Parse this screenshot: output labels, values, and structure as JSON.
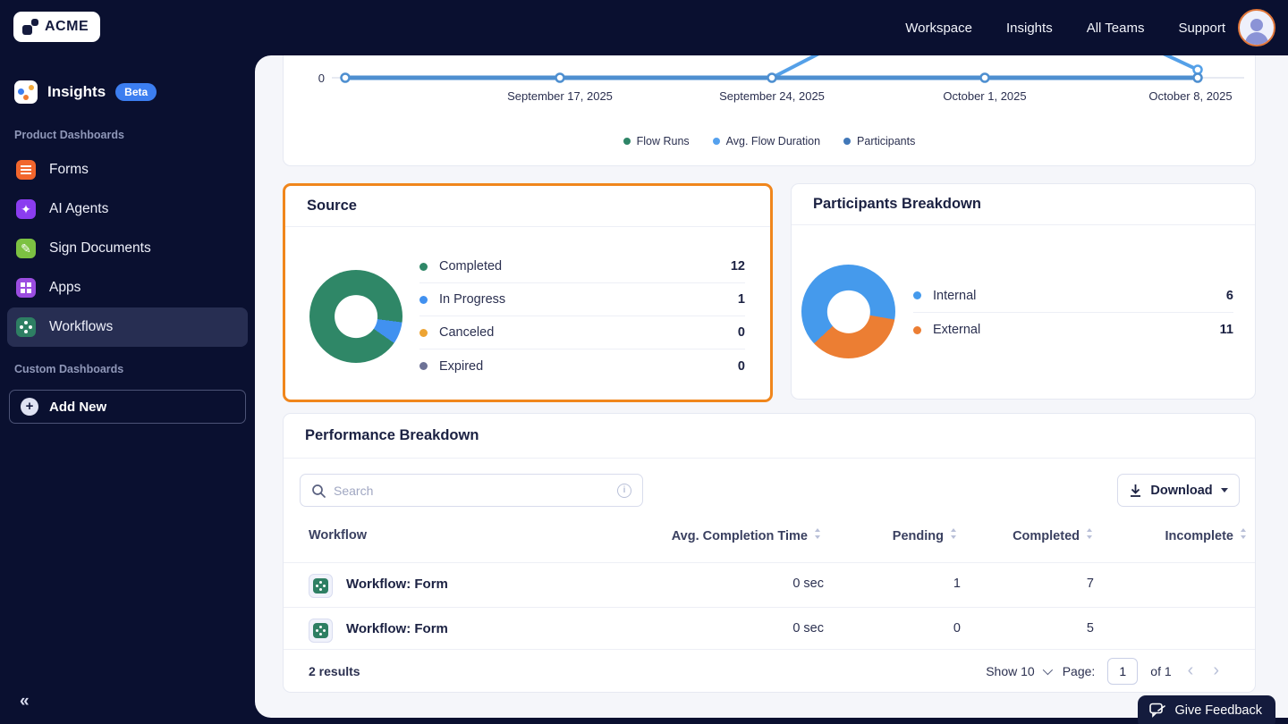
{
  "topnav": {
    "brand": "ACME",
    "links": [
      {
        "label": "Workspace"
      },
      {
        "label": "Insights"
      },
      {
        "label": "All Teams"
      },
      {
        "label": "Support"
      }
    ]
  },
  "sidebar": {
    "app_label": "Insights",
    "app_badge": "Beta",
    "section_product": "Product Dashboards",
    "section_custom": "Custom Dashboards",
    "items": [
      {
        "label": "Forms",
        "icon": "forms-icon",
        "icon_color": "#f2662d",
        "active": false
      },
      {
        "label": "AI Agents",
        "icon": "ai-agents-icon",
        "icon_color": "#8b3df0",
        "active": false
      },
      {
        "label": "Sign Documents",
        "icon": "sign-documents-icon",
        "icon_color": "#7cc142",
        "active": false
      },
      {
        "label": "Apps",
        "icon": "apps-icon",
        "icon_color": "#9b4de0",
        "active": false
      },
      {
        "label": "Workflows",
        "icon": "workflows-icon",
        "icon_color": "#2e7f63",
        "active": true
      }
    ],
    "add_new": "Add New",
    "collapse_icon": "«"
  },
  "chart_data": [
    {
      "type": "line",
      "title": "",
      "y_tick": "0",
      "x_ticks": [
        "September 17, 2025",
        "September 24, 2025",
        "October 1, 2025",
        "October 8, 2025"
      ],
      "note": "Top of chart clipped by viewport; all visible points sit at 0. Avg. Flow Duration rises after September 24, peaks above the visible area near October 1, and returns to just above 0 at October 8.",
      "series": [
        {
          "name": "Flow Runs",
          "color": "#2e8567",
          "values": [
            0,
            0,
            0,
            0,
            0
          ]
        },
        {
          "name": "Avg. Flow Duration",
          "color": "#55a1ee",
          "values": [
            0,
            0,
            0,
            null,
            0
          ]
        },
        {
          "name": "Participants",
          "color": "#4178b8",
          "values": [
            0,
            0,
            0,
            0,
            0
          ]
        }
      ]
    },
    {
      "type": "pie",
      "title": "Source",
      "labels": [
        "Completed",
        "In Progress",
        "Canceled",
        "Expired"
      ],
      "values": [
        12,
        1,
        0,
        0
      ],
      "colors": [
        "#2f8767",
        "#4191f0",
        "#eda433",
        "#6d7296"
      ]
    },
    {
      "type": "pie",
      "title": "Participants Breakdown",
      "labels": [
        "Internal",
        "External"
      ],
      "values": [
        6,
        11
      ],
      "colors": [
        "#459aec",
        "#ec7e33"
      ]
    }
  ],
  "cards": {
    "source": {
      "title": "Source",
      "rows": [
        {
          "label": "Completed",
          "value": "12",
          "color": "#2f8767"
        },
        {
          "label": "In Progress",
          "value": "1",
          "color": "#4191f0"
        },
        {
          "label": "Canceled",
          "value": "0",
          "color": "#eda433"
        },
        {
          "label": "Expired",
          "value": "0",
          "color": "#6d7296"
        }
      ],
      "donut": {
        "start_deg": 125,
        "segments": [
          {
            "color": "#2f8767",
            "value": 12
          },
          {
            "color": "#4191f0",
            "value": 1
          }
        ]
      }
    },
    "participants": {
      "title": "Participants Breakdown",
      "rows": [
        {
          "label": "Internal",
          "value": "6",
          "color": "#459aec"
        },
        {
          "label": "External",
          "value": "11",
          "color": "#ec7e33"
        }
      ],
      "donut": {
        "start_deg": 227,
        "segments": [
          {
            "color": "#459aec",
            "value": 11
          },
          {
            "color": "#ec7e33",
            "value": 6
          }
        ]
      }
    }
  },
  "performance": {
    "title": "Performance Breakdown",
    "search_placeholder": "Search",
    "download": "Download",
    "table": {
      "columns": [
        "Workflow",
        "Avg. Completion Time",
        "Pending",
        "Completed",
        "Incomplete"
      ],
      "rows": [
        {
          "name": "Workflow: Form",
          "avg_completion_time": "0 sec",
          "pending": "1",
          "completed": "7",
          "incomplete": ""
        },
        {
          "name": "Workflow: Form",
          "avg_completion_time": "0 sec",
          "pending": "0",
          "completed": "5",
          "incomplete": ""
        }
      ]
    },
    "footer": {
      "results": "2 results",
      "show": "Show 10",
      "page_label": "Page:",
      "page_value": "1",
      "of": "of 1"
    }
  },
  "feedback": {
    "label": "Give Feedback"
  }
}
